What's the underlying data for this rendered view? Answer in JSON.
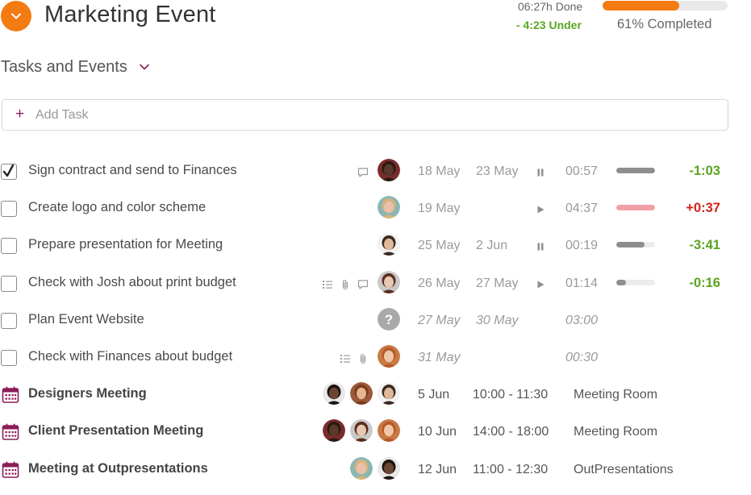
{
  "header": {
    "title": "Marketing Event",
    "done_text": "06:27h Done",
    "under_text": "- 4:23 Under",
    "progress_percent": 61,
    "completed_text": "61% Completed",
    "accent_color": "#f47a12"
  },
  "section": {
    "title": "Tasks and Events"
  },
  "add_task": {
    "label": "Add Task"
  },
  "tasks": [
    {
      "name": "Sign contract and send to Finances",
      "checked": true,
      "icons": [
        "comment-icon"
      ],
      "avatar": "avatar-dark-man",
      "start": "18 May",
      "end": "23 May",
      "italic": false,
      "control": "pause-icon",
      "timer": "00:57",
      "progress": 1.0,
      "bar_color": "#8e8e8e",
      "delta": "-1:03",
      "delta_color": "#5aa51f"
    },
    {
      "name": "Create logo and color scheme",
      "checked": false,
      "icons": [],
      "avatar": "avatar-blonde-woman",
      "start": "19 May",
      "end": "",
      "italic": false,
      "control": "play-icon",
      "timer": "04:37",
      "progress": 1.0,
      "bar_color": "#f2a0a6",
      "delta": "+0:37",
      "delta_color": "#d0231c"
    },
    {
      "name": "Prepare presentation for Meeting",
      "checked": false,
      "icons": [],
      "avatar": "avatar-long-hair-man",
      "start": "25 May",
      "end": "2 Jun",
      "italic": false,
      "control": "pause-icon",
      "timer": "00:19",
      "progress": 0.72,
      "bar_color": "#8e8e8e",
      "delta": "-3:41",
      "delta_color": "#5aa51f"
    },
    {
      "name": "Check with Josh about print budget",
      "checked": false,
      "icons": [
        "list-icon",
        "attachment-icon",
        "comment-icon"
      ],
      "avatar": "avatar-brunette-woman",
      "start": "26 May",
      "end": "27 May",
      "italic": false,
      "control": "play-icon",
      "timer": "01:14",
      "progress": 0.25,
      "bar_color": "#8e8e8e",
      "delta": "-0:16",
      "delta_color": "#5aa51f"
    },
    {
      "name": "Plan Event Website",
      "checked": false,
      "icons": [],
      "avatar": "avatar-unassigned",
      "start": "27 May",
      "end": "30 May",
      "italic": true,
      "control": "",
      "timer": "03:00",
      "progress": null,
      "bar_color": "",
      "delta": "",
      "delta_color": ""
    },
    {
      "name": "Check with Finances about budget",
      "checked": false,
      "icons": [
        "list-icon",
        "attachment-icon"
      ],
      "avatar": "avatar-redhead-woman",
      "start": "31 May",
      "end": "",
      "italic": true,
      "control": "",
      "timer": "00:30",
      "progress": null,
      "bar_color": "",
      "delta": "",
      "delta_color": ""
    }
  ],
  "events": [
    {
      "name": "Designers Meeting",
      "avatars": [
        "avatar-dark-woman",
        "avatar-bearded-man",
        "avatar-long-hair-man"
      ],
      "date": "5 Jun",
      "time": "10:00 - 11:30",
      "place": "Meeting Room"
    },
    {
      "name": "Client Presentation Meeting",
      "avatars": [
        "avatar-dark-man",
        "avatar-brunette-woman",
        "avatar-redhead-woman"
      ],
      "date": "10 Jun",
      "time": "14:00 - 18:00",
      "place": "Meeting Room"
    },
    {
      "name": "Meeting at Outpresentations",
      "avatars": [
        "avatar-blonde-woman",
        "avatar-dark-woman"
      ],
      "date": "12 Jun",
      "time": "11:00 - 12:30",
      "place": "OutPresentations"
    }
  ],
  "colors": {
    "event_icon": "#8b1d5a",
    "positive": "#5aa51f",
    "negative": "#d0231c"
  }
}
